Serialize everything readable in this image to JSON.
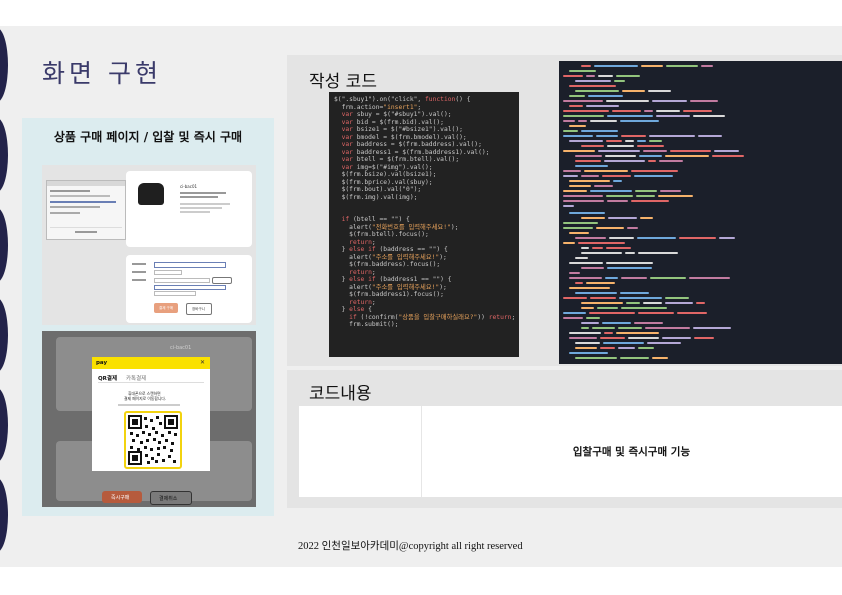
{
  "page": {
    "title": "화면 구현",
    "footer": "2022 인천일보아카데미@copyright all right reserved"
  },
  "left_panel": {
    "heading": "상품 구매 페이지 / 입찰 및 즉시 구매",
    "screenshot1": {
      "product_name": "ci-bac01",
      "buttons": [
        "결제 구매",
        "장바구니"
      ]
    },
    "screenshot2": {
      "product_name": "ci-bac01",
      "modal": {
        "brand": "pay",
        "close": "✕",
        "tab_active": "QR결제",
        "tab_inactive": "카톡결제",
        "line1": "휴대폰으로 스캔하면",
        "line2": "결제 페이지로 이동합니다."
      },
      "buttons": [
        "즉시구매",
        "결제취소"
      ]
    }
  },
  "code_section": {
    "label": "작성 코드",
    "lines": [
      {
        "parts": [
          [
            "t",
            "$(\".sbuy1\").on(\"click\", "
          ],
          [
            "k",
            "function"
          ],
          [
            "t",
            "() {"
          ]
        ]
      },
      {
        "parts": [
          [
            "t",
            "  frm.action="
          ],
          [
            "s",
            "\"insert1\""
          ],
          [
            "t",
            ";"
          ]
        ]
      },
      {
        "parts": [
          [
            "k",
            "  var"
          ],
          [
            "t",
            " sbuy = $(\"#sbuy1\").val();"
          ]
        ]
      },
      {
        "parts": [
          [
            "k",
            "  var"
          ],
          [
            "t",
            " bid = $(frm.bid).val();"
          ]
        ]
      },
      {
        "parts": [
          [
            "k",
            "  var"
          ],
          [
            "t",
            " bsize1 = $(\"#bsize1\").val();"
          ]
        ]
      },
      {
        "parts": [
          [
            "k",
            "  var"
          ],
          [
            "t",
            " bmodel = $(frm.bmodel).val();"
          ]
        ]
      },
      {
        "parts": [
          [
            "k",
            "  var"
          ],
          [
            "t",
            " baddress = $(frm.baddress).val();"
          ]
        ]
      },
      {
        "parts": [
          [
            "k",
            "  var"
          ],
          [
            "t",
            " baddress1 = $(frm.baddress1).val();"
          ]
        ]
      },
      {
        "parts": [
          [
            "k",
            "  var"
          ],
          [
            "t",
            " btell = $(frm.btell).val();"
          ]
        ]
      },
      {
        "parts": [
          [
            "k",
            "  var"
          ],
          [
            "t",
            " img=$(\"#img\").val();"
          ]
        ]
      },
      {
        "parts": [
          [
            "t",
            "  $(frm.bsize).val(bsize1);"
          ]
        ]
      },
      {
        "parts": [
          [
            "t",
            "  $(frm.bprice).val(sbuy);"
          ]
        ]
      },
      {
        "parts": [
          [
            "t",
            "  $(frm.bout).val(\"0\");"
          ]
        ]
      },
      {
        "parts": [
          [
            "t",
            "  $(frm.img).val(img);"
          ]
        ]
      },
      {
        "parts": [
          [
            "t",
            ""
          ]
        ]
      },
      {
        "parts": [
          [
            "t",
            ""
          ]
        ]
      },
      {
        "parts": [
          [
            "k",
            "  if"
          ],
          [
            "t",
            " (btell == \"\") {"
          ]
        ]
      },
      {
        "parts": [
          [
            "t",
            "    alert("
          ],
          [
            "s",
            "\"전화번호를 입력해주세요!\""
          ],
          [
            "t",
            ");"
          ]
        ]
      },
      {
        "parts": [
          [
            "t",
            "    $(frm.btell).focus();"
          ]
        ]
      },
      {
        "parts": [
          [
            "k",
            "    return"
          ],
          [
            "t",
            ";"
          ]
        ]
      },
      {
        "parts": [
          [
            "t",
            "  } "
          ],
          [
            "k",
            "else if"
          ],
          [
            "t",
            " (baddress == \"\") {"
          ]
        ]
      },
      {
        "parts": [
          [
            "t",
            "    alert("
          ],
          [
            "s",
            "\"주소를 입력해주세요!\""
          ],
          [
            "t",
            ");"
          ]
        ]
      },
      {
        "parts": [
          [
            "t",
            "    $(frm.baddress).focus();"
          ]
        ]
      },
      {
        "parts": [
          [
            "k",
            "    return"
          ],
          [
            "t",
            ";"
          ]
        ]
      },
      {
        "parts": [
          [
            "t",
            "  } "
          ],
          [
            "k",
            "else if"
          ],
          [
            "t",
            " (baddress1 == \"\") {"
          ]
        ]
      },
      {
        "parts": [
          [
            "t",
            "    alert("
          ],
          [
            "s",
            "\"주소를 입력해주세요!\""
          ],
          [
            "t",
            ");"
          ]
        ]
      },
      {
        "parts": [
          [
            "t",
            "    $(frm.baddress1).focus();"
          ]
        ]
      },
      {
        "parts": [
          [
            "k",
            "    return"
          ],
          [
            "t",
            ";"
          ]
        ]
      },
      {
        "parts": [
          [
            "t",
            "  } "
          ],
          [
            "k",
            "else"
          ],
          [
            "t",
            " {"
          ]
        ]
      },
      {
        "parts": [
          [
            "k",
            "    if"
          ],
          [
            "t",
            " (!confirm("
          ],
          [
            "s",
            "\"상품을 입찰구매하실래요?\""
          ],
          [
            "t",
            ")) "
          ],
          [
            "k",
            "return"
          ],
          [
            "t",
            ";"
          ]
        ]
      },
      {
        "parts": [
          [
            "t",
            "    frm.submit();"
          ]
        ]
      }
    ]
  },
  "content_section": {
    "label": "코드내용",
    "description": "입찰구매 및 즉시구매 기능"
  },
  "colors": {
    "navy": "#23234a",
    "panel_bg": "#dcecef",
    "code_keyword": "#e06666",
    "code_string": "#e8a35c",
    "kakao_yellow": "#fae100"
  }
}
